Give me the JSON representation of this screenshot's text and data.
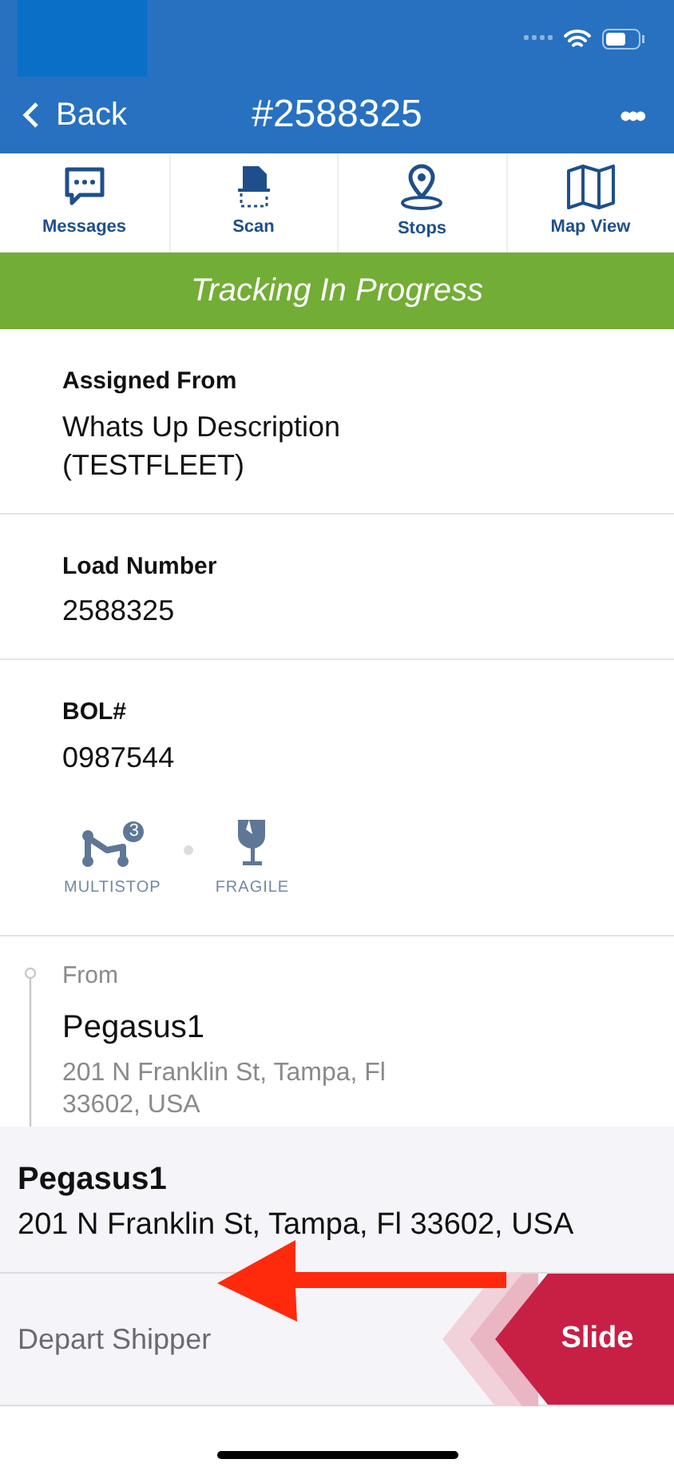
{
  "nav": {
    "back": "Back",
    "title": "#2588325",
    "more": "•••"
  },
  "toolbar": [
    {
      "label": "Messages",
      "kind": "chat"
    },
    {
      "label": "Scan",
      "kind": "scan"
    },
    {
      "label": "Stops",
      "kind": "pin"
    },
    {
      "label": "Map View",
      "kind": "map"
    }
  ],
  "status_banner": "Tracking In Progress",
  "fields": [
    {
      "label": "Assigned From",
      "value": "Whats Up Description\n(TESTFLEET)"
    },
    {
      "label": "Load Number",
      "value": "2588325"
    },
    {
      "label": "BOL#",
      "value": "0987544"
    }
  ],
  "tags": [
    {
      "kind": "multistop",
      "label": "MULTISTOP",
      "badge": "3"
    },
    {
      "kind": "fragile",
      "label": "FRAGILE"
    }
  ],
  "route": {
    "label": "From",
    "name": "Pegasus1",
    "address": "201 N Franklin St, Tampa, Fl\n33602, USA"
  },
  "sheet": {
    "name": "Pegasus1",
    "address": "201 N Franklin St, Tampa, Fl 33602, USA"
  },
  "slider": {
    "hint": "Depart Shipper",
    "button": "Slide"
  }
}
